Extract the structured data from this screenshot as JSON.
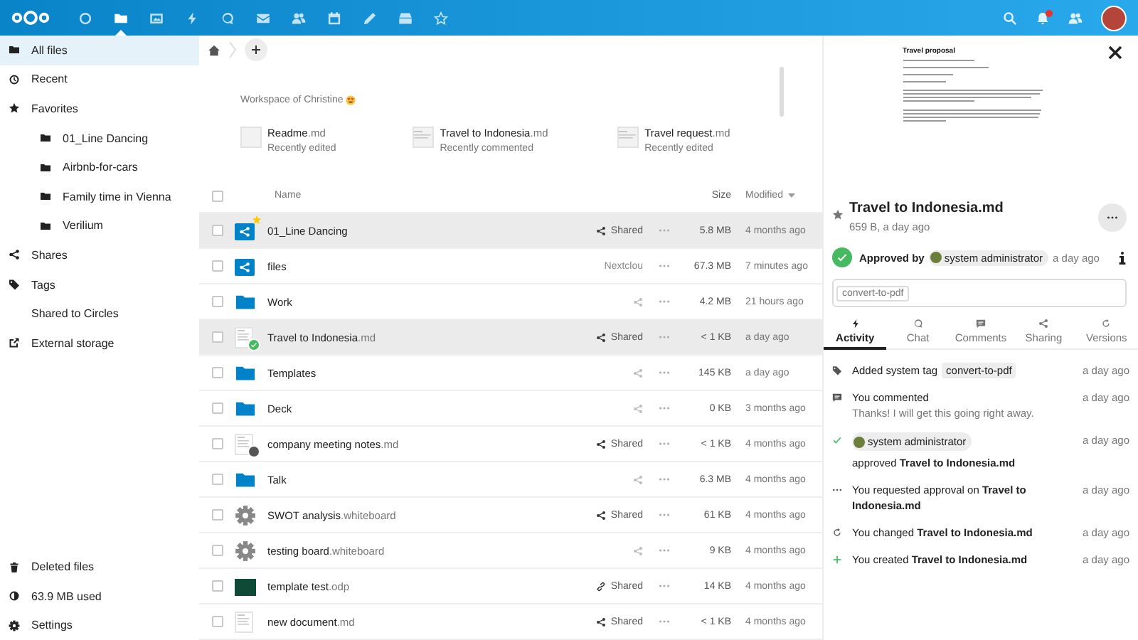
{
  "apps": [
    {
      "kind": "circle",
      "selected": false
    },
    {
      "kind": "folder",
      "selected": true
    },
    {
      "kind": "image",
      "selected": false
    },
    {
      "kind": "bolt",
      "selected": false
    },
    {
      "kind": "chat",
      "selected": false
    },
    {
      "kind": "mail",
      "selected": false
    },
    {
      "kind": "people",
      "selected": false
    },
    {
      "kind": "calendar",
      "selected": false
    },
    {
      "kind": "pencil",
      "selected": false
    },
    {
      "kind": "archive",
      "selected": false
    },
    {
      "kind": "star-outline",
      "selected": false
    }
  ],
  "navigation": {
    "items": [
      {
        "kind": "folder",
        "label": "All files",
        "selected": true
      },
      {
        "kind": "clock",
        "label": "Recent",
        "selected": false
      },
      {
        "kind": "star",
        "label": "Favorites",
        "selected": false,
        "children": [
          {
            "kind": "folder",
            "label": "01_Line Dancing",
            "selected": false
          },
          {
            "kind": "folder",
            "label": "Airbnb-for-cars",
            "selected": false
          },
          {
            "kind": "folder",
            "label": "Family time in Vienna",
            "selected": false
          },
          {
            "kind": "folder",
            "label": "Verilium",
            "selected": false
          }
        ]
      },
      {
        "kind": "share",
        "label": "Shares",
        "selected": false
      },
      {
        "kind": "tag",
        "label": "Tags",
        "selected": false
      },
      {
        "label": "Shared to Circles",
        "selected": false
      },
      {
        "kind": "external",
        "label": "External storage",
        "selected": false
      }
    ],
    "footer": [
      {
        "kind": "trash",
        "label": "Deleted files"
      },
      {
        "kind": "pie",
        "label": "63.9 MB used"
      },
      {
        "kind": "gear",
        "label": "Settings"
      }
    ]
  },
  "recent": {
    "title": "Workspace of Christine",
    "items": [
      {
        "base": "Readme",
        "ext": ".md",
        "note": "Recently edited",
        "preview": false
      },
      {
        "base": "Travel to Indonesia",
        "ext": ".md",
        "note": "Recently commented",
        "preview": true
      },
      {
        "base": "Travel request",
        "ext": ".md",
        "note": "Recently edited",
        "preview": true
      }
    ]
  },
  "table": {
    "all_checked": false,
    "columns": [
      "Name",
      "Size",
      "Modified"
    ],
    "rows": [
      {
        "checked": false,
        "selected": true,
        "kind": "shared-folder",
        "base": "01_Line Dancing",
        "favorite": true,
        "approved": false,
        "owner_avatar": false,
        "share": {
          "kind": "shared",
          "label": "Shared"
        },
        "size": "5.8 MB",
        "modified": "4 months ago"
      },
      {
        "checked": false,
        "selected": false,
        "kind": "shared-folder",
        "base": "files",
        "favorite": false,
        "approved": false,
        "owner_avatar": false,
        "share": {
          "kind": "text",
          "label": "Nextclou"
        },
        "size": "67.3 MB",
        "modified": "7 minutes ago"
      },
      {
        "checked": false,
        "selected": false,
        "kind": "folder",
        "base": "Work",
        "favorite": false,
        "approved": false,
        "owner_avatar": false,
        "share": {
          "kind": "icon"
        },
        "size": "4.2 MB",
        "modified": "21 hours ago"
      },
      {
        "checked": false,
        "selected": true,
        "kind": "document",
        "base": "Travel to Indonesia",
        "ext": ".md",
        "favorite": false,
        "approved": true,
        "owner_avatar": false,
        "share": {
          "kind": "shared",
          "label": "Shared"
        },
        "size": "< 1 KB",
        "modified": "a day ago"
      },
      {
        "checked": false,
        "selected": false,
        "kind": "folder",
        "base": "Templates",
        "favorite": false,
        "approved": false,
        "owner_avatar": false,
        "share": {
          "kind": "icon"
        },
        "size": "145 KB",
        "modified": "a day ago"
      },
      {
        "checked": false,
        "selected": false,
        "kind": "folder",
        "base": "Deck",
        "favorite": false,
        "approved": false,
        "owner_avatar": false,
        "share": {
          "kind": "icon"
        },
        "size": "0 KB",
        "modified": "3 months ago"
      },
      {
        "checked": false,
        "selected": false,
        "kind": "document",
        "base": "company meeting notes",
        "ext": ".md",
        "favorite": false,
        "approved": false,
        "owner_avatar": true,
        "share": {
          "kind": "shared",
          "label": "Shared"
        },
        "size": "< 1 KB",
        "modified": "4 months ago"
      },
      {
        "checked": false,
        "selected": false,
        "kind": "folder",
        "base": "Talk",
        "favorite": false,
        "approved": false,
        "owner_avatar": false,
        "share": {
          "kind": "icon"
        },
        "size": "6.3 MB",
        "modified": "4 months ago"
      },
      {
        "checked": false,
        "selected": false,
        "kind": "whiteboard",
        "base": "SWOT analysis",
        "ext": ".whiteboard",
        "favorite": false,
        "approved": false,
        "owner_avatar": false,
        "share": {
          "kind": "shared",
          "label": "Shared"
        },
        "size": "61 KB",
        "modified": "4 months ago"
      },
      {
        "checked": false,
        "selected": false,
        "kind": "whiteboard",
        "base": "testing board",
        "ext": ".whiteboard",
        "favorite": false,
        "approved": false,
        "owner_avatar": false,
        "share": {
          "kind": "icon"
        },
        "size": "9 KB",
        "modified": "4 months ago"
      },
      {
        "checked": false,
        "selected": false,
        "kind": "presentation",
        "base": "template test",
        "ext": ".odp",
        "favorite": false,
        "approved": false,
        "owner_avatar": false,
        "share": {
          "kind": "link",
          "label": "Shared"
        },
        "size": "14 KB",
        "modified": "4 months ago"
      },
      {
        "checked": false,
        "selected": false,
        "kind": "document",
        "base": "new document",
        "ext": ".md",
        "favorite": false,
        "approved": false,
        "owner_avatar": false,
        "share": {
          "kind": "shared",
          "label": "Shared"
        },
        "size": "< 1 KB",
        "modified": "4 months ago"
      }
    ]
  },
  "details": {
    "preview": {
      "title": "Travel proposal"
    },
    "favorite": false,
    "name": "Travel to Indonesia.md",
    "meta": "659 B, a day ago",
    "approval": {
      "label": "Approved by",
      "user": "system administrator",
      "time": "a day ago"
    },
    "tags": [
      "convert-to-pdf"
    ],
    "tabs": [
      {
        "kind": "bolt",
        "label": "Activity",
        "selected": true
      },
      {
        "kind": "chat",
        "label": "Chat",
        "selected": false
      },
      {
        "kind": "comment",
        "label": "Comments",
        "selected": false
      },
      {
        "kind": "share",
        "label": "Sharing",
        "selected": false
      },
      {
        "kind": "refresh",
        "label": "Versions",
        "selected": false
      }
    ],
    "activity": [
      {
        "kind": "tag",
        "text": "Added system tag",
        "tag": "convert-to-pdf",
        "time": "a day ago"
      },
      {
        "kind": "comment",
        "text": "You commented",
        "comment": "Thanks! I will get this going right away.",
        "time": "a day ago"
      },
      {
        "kind": "check",
        "user": "system administrator",
        "text": "approved **Travel to Indonesia.md**",
        "time": "a day ago"
      },
      {
        "kind": "dots",
        "text": "You requested approval on **Travel to Indonesia.md**",
        "time": "a day ago"
      },
      {
        "kind": "refresh",
        "text": "You changed **Travel to Indonesia.md**",
        "time": "a day ago"
      },
      {
        "kind": "plus",
        "text": "You created **Travel to Indonesia.md**",
        "time": "a day ago"
      }
    ]
  }
}
